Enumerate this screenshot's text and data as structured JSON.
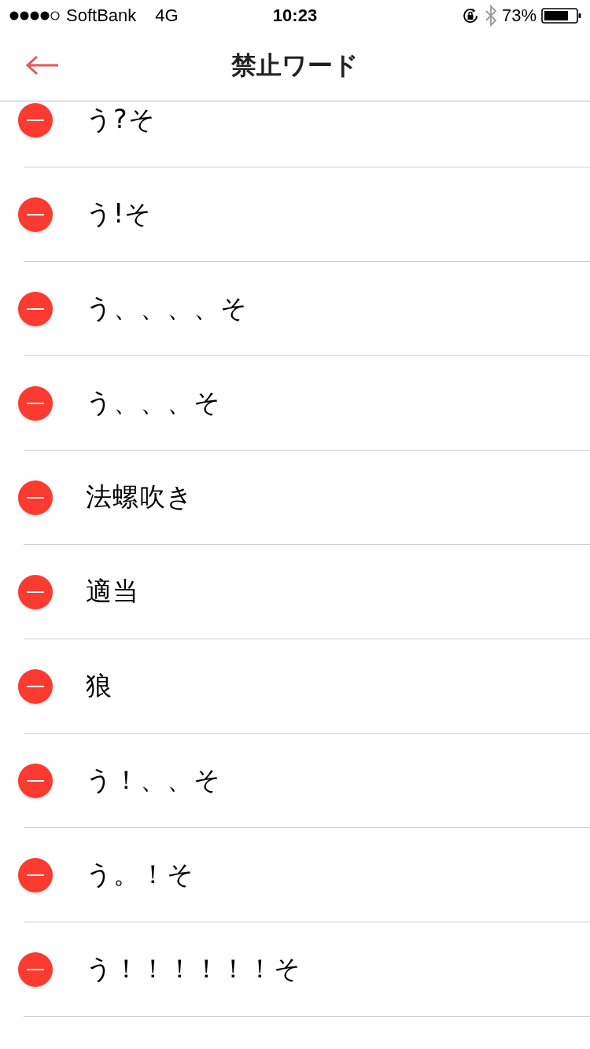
{
  "status_bar": {
    "carrier": "SoftBank",
    "network": "4G",
    "time": "10:23",
    "battery_percent": "73%"
  },
  "nav_bar": {
    "title": "禁止ワード"
  },
  "words": [
    {
      "text": "う?そ"
    },
    {
      "text": "う!そ"
    },
    {
      "text": "う、、、、そ"
    },
    {
      "text": "う、、、そ"
    },
    {
      "text": "法螺吹き"
    },
    {
      "text": "適当"
    },
    {
      "text": "狼"
    },
    {
      "text": "う！、、そ"
    },
    {
      "text": "う。！そ"
    },
    {
      "text": "う！！！！！！そ"
    }
  ]
}
